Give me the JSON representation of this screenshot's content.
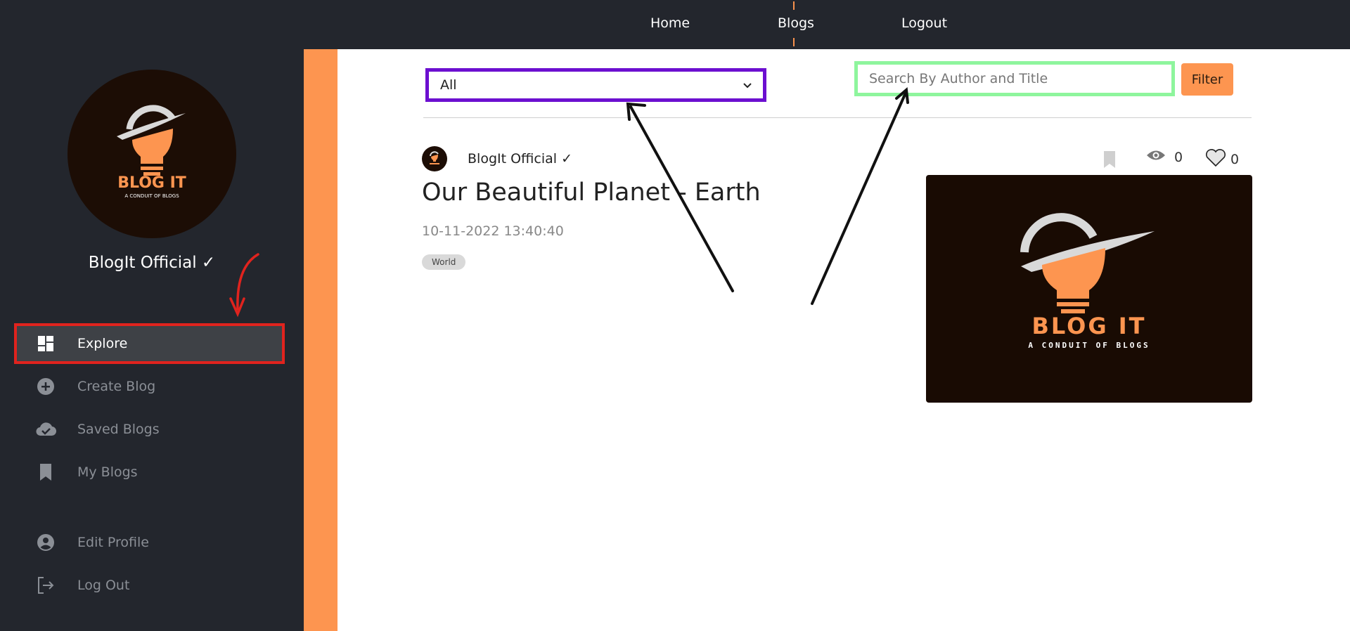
{
  "nav": {
    "links": [
      {
        "label": "Home"
      },
      {
        "label": "Blogs"
      },
      {
        "label": "Logout"
      }
    ],
    "accent": "#f7914d",
    "background": "#23262d"
  },
  "sidebar": {
    "logo_text": "BLOG IT",
    "logo_tagline": "A CONDUIT OF BLOGS",
    "user_name": "BlogIt Official ✓",
    "items": [
      {
        "label": "Explore",
        "icon": "dashboard-icon",
        "active": true
      },
      {
        "label": "Create Blog",
        "icon": "plus-circle-icon"
      },
      {
        "label": "Saved Blogs",
        "icon": "cloud-check-icon"
      },
      {
        "label": "My Blogs",
        "icon": "bookmark-icon"
      },
      {
        "label": "Edit Profile",
        "icon": "user-circle-icon"
      },
      {
        "label": "Log Out",
        "icon": "logout-icon"
      }
    ]
  },
  "filters": {
    "category_selected": "All",
    "search_placeholder": "Search By Author and Title",
    "filter_label": "Filter"
  },
  "post": {
    "author": "BlogIt Official ✓",
    "title": "Our Beautiful Planet - Earth",
    "date": "10-11-2022 13:40:40",
    "tag": "World",
    "views": "0",
    "likes": "0",
    "image_logo_text": "BLOG IT",
    "image_logo_tagline": "A CONDUIT OF BLOGS"
  },
  "colors": {
    "brand_orange": "#fd9550",
    "sidebar_bg": "#23262d",
    "annotation_red": "#e0231e",
    "annotation_purple": "#6c0fd0",
    "annotation_green": "#8ef59d"
  }
}
